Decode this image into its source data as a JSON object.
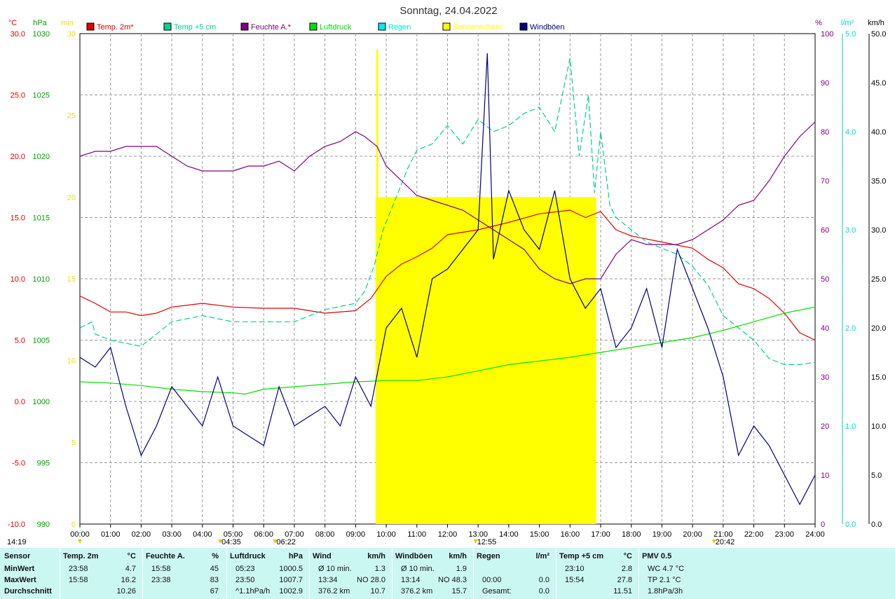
{
  "chart_data": {
    "type": "line",
    "title": "Sonntag, 24.04.2022",
    "x_labels": [
      "00:00",
      "01:00",
      "02:00",
      "03:00",
      "04:00",
      "05:00",
      "06:00",
      "07:00",
      "08:00",
      "09:00",
      "10:00",
      "11:00",
      "12:00",
      "13:00",
      "14:00",
      "15:00",
      "16:00",
      "17:00",
      "18:00",
      "19:00",
      "20:00",
      "21:00",
      "22:00",
      "23:00",
      "24:00"
    ],
    "axes": {
      "temp_c": {
        "unit": "°C",
        "ylim": [
          -10,
          30
        ],
        "ticks": [
          "30.0",
          "25.0",
          "20.0",
          "15.0",
          "10.0",
          "5.0",
          "0.0",
          "-5.0",
          "-10.0"
        ],
        "color": "#e00000"
      },
      "pressure_hpa": {
        "unit": "hPa",
        "ylim": [
          990,
          1030
        ],
        "ticks": [
          "1030",
          "1025",
          "1020",
          "1015",
          "1010",
          "1005",
          "1000",
          "995",
          "990"
        ],
        "color": "#00a000"
      },
      "sun_min": {
        "unit": "min",
        "ylim": [
          0,
          30
        ],
        "ticks": [
          "30",
          "25",
          "20",
          "15",
          "10",
          "5",
          "0"
        ],
        "color": "#e8e000"
      },
      "humidity_pct": {
        "unit": "%",
        "ylim": [
          0,
          100
        ],
        "ticks": [
          "100",
          "90",
          "80",
          "70",
          "60",
          "50",
          "40",
          "30",
          "20",
          "10",
          "0"
        ],
        "color": "#800080"
      },
      "rain_lm2": {
        "unit": "l/m²",
        "ylim": [
          0,
          5
        ],
        "ticks": [
          "5.0",
          "4.0",
          "3.0",
          "2.0",
          "1.0",
          "0.0"
        ],
        "color": "#00d8d8"
      },
      "wind_kmh": {
        "unit": "km/h",
        "ylim": [
          0,
          50
        ],
        "ticks": [
          "50.0",
          "45.0",
          "40.0",
          "35.0",
          "30.0",
          "25.0",
          "20.0",
          "15.0",
          "10.0",
          "5.0",
          "0.0"
        ],
        "color": "#000000"
      }
    },
    "legend": [
      {
        "name": "Temp. 2m*",
        "color": "#e00000"
      },
      {
        "name": "Temp +5 cm",
        "color": "#00d090"
      },
      {
        "name": "Feuchte A.*",
        "color": "#800080"
      },
      {
        "name": "Luftdruck",
        "color": "#00e000"
      },
      {
        "name": "Regen",
        "color": "#00e8e8"
      },
      {
        "name": "Sonnenschein",
        "color": "#ffff00"
      },
      {
        "name": "Windböen",
        "color": "#000080"
      }
    ],
    "series": [
      {
        "name": "Temp. 2m*",
        "axis": "temp_c",
        "x": [
          0,
          0.5,
          1,
          1.5,
          2,
          2.5,
          3,
          4,
          5,
          6,
          7,
          8,
          9,
          9.5,
          10,
          10.5,
          11,
          11.5,
          12,
          13,
          14,
          15,
          16,
          16.5,
          17,
          17.5,
          18,
          19,
          20,
          20.5,
          21,
          21.5,
          22,
          22.5,
          23,
          23.5,
          24
        ],
        "y": [
          8.6,
          8,
          7.3,
          7.3,
          7,
          7.2,
          7.7,
          8,
          7.7,
          7.6,
          7.6,
          7.2,
          7.4,
          8.4,
          10.2,
          11.2,
          11.8,
          12.5,
          13.6,
          14,
          14.6,
          15.3,
          15.6,
          15,
          15.5,
          14,
          13.5,
          13,
          12.5,
          11.6,
          10.9,
          9.6,
          9.2,
          8.4,
          7.2,
          5.6,
          5
        ]
      },
      {
        "name": "Temp +5 cm",
        "axis": "temp_c",
        "x": [
          0,
          0.4,
          0.5,
          1,
          2,
          3,
          4,
          5,
          6,
          7,
          8,
          9,
          9.3,
          9.6,
          9.9,
          10.3,
          10.7,
          11,
          11.5,
          12,
          12.5,
          13,
          13.5,
          14,
          14.5,
          15,
          15.5,
          16,
          16.3,
          16.6,
          16.8,
          17,
          17.3,
          17.5,
          18,
          18.5,
          19,
          19.5,
          20,
          20.5,
          21,
          21.5,
          22,
          22.5,
          23,
          23.5,
          24
        ],
        "y": [
          6,
          6.5,
          5.5,
          5,
          4.5,
          6.5,
          7,
          6.5,
          6.5,
          6.5,
          7.5,
          8,
          9,
          11,
          14,
          16.5,
          19,
          20.5,
          21,
          22.5,
          21,
          23,
          22,
          22.5,
          23.5,
          24,
          22,
          28,
          20,
          25,
          17,
          22,
          16,
          15,
          14,
          13,
          12.5,
          12,
          11,
          9.5,
          7,
          6,
          5,
          3.5,
          3,
          3,
          3.2
        ]
      },
      {
        "name": "Feuchte A.*",
        "axis": "humidity_pct",
        "x": [
          0,
          0.5,
          1,
          1.5,
          2,
          2.5,
          3,
          3.5,
          4,
          4.5,
          5,
          5.5,
          6,
          6.5,
          7,
          7.5,
          8,
          8.5,
          9,
          9.3,
          9.7,
          10,
          10.5,
          11,
          11.5,
          12,
          12.5,
          13,
          13.5,
          14,
          14.5,
          15,
          15.5,
          16,
          16.5,
          17,
          17.5,
          18,
          18.5,
          19,
          19.5,
          20,
          20.5,
          21,
          21.5,
          22,
          22.5,
          23,
          23.5,
          24
        ],
        "y": [
          75,
          76,
          76,
          77,
          77,
          77,
          75,
          73,
          72,
          72,
          72,
          73,
          73,
          74,
          72,
          75,
          77,
          78,
          80,
          79,
          77,
          73,
          70,
          67,
          66,
          65,
          64,
          62,
          60,
          58,
          56,
          52,
          50,
          49,
          50,
          50,
          55,
          58,
          57,
          57,
          57,
          58,
          60,
          62,
          65,
          66,
          70,
          75,
          79,
          82
        ]
      },
      {
        "name": "Luftdruck",
        "axis": "pressure_hpa",
        "x": [
          0,
          1,
          2,
          3,
          4,
          5,
          5.4,
          6,
          7,
          8,
          9,
          10,
          11,
          12,
          13,
          14,
          15,
          16,
          17,
          18,
          19,
          20,
          21,
          22,
          23,
          24
        ],
        "y": [
          1001.6,
          1001.5,
          1001.3,
          1001,
          1000.8,
          1000.7,
          1000.6,
          1001,
          1001.2,
          1001.4,
          1001.6,
          1001.7,
          1001.7,
          1002,
          1002.5,
          1003,
          1003.3,
          1003.6,
          1004,
          1004.4,
          1004.8,
          1005.2,
          1005.8,
          1006.5,
          1007.2,
          1007.7
        ]
      },
      {
        "name": "Windböen",
        "axis": "wind_kmh",
        "x": [
          0,
          0.5,
          1,
          1.5,
          2,
          2.5,
          3,
          3.5,
          4,
          4.5,
          5,
          5.5,
          6,
          6.5,
          7,
          7.5,
          8,
          8.5,
          9,
          9.5,
          10,
          10.5,
          11,
          11.5,
          12,
          12.5,
          13,
          13.3,
          13.5,
          14,
          14.5,
          15,
          15.5,
          16,
          16.5,
          17,
          17.5,
          18,
          18.5,
          19,
          19.5,
          20,
          20.5,
          21,
          21.5,
          22,
          22.5,
          23,
          23.5,
          24
        ],
        "y": [
          17,
          16,
          18,
          12,
          7,
          10,
          14,
          12,
          10,
          15,
          10,
          9,
          8,
          14,
          10,
          11,
          12,
          10,
          15,
          12,
          20,
          22,
          17,
          25,
          26,
          28,
          30,
          48,
          27,
          34,
          30,
          28,
          34,
          25,
          22,
          24,
          18,
          20,
          24,
          18,
          28,
          24,
          20,
          15,
          7,
          10,
          8,
          5,
          2,
          5
        ]
      }
    ],
    "sunshine": {
      "name": "Sonnenschein",
      "axis": "sun_min",
      "x_start": 9.65,
      "x_end": 16.85,
      "value": 20,
      "peak": {
        "x": 9.72,
        "value": 29
      }
    },
    "markers": [
      {
        "label": "14:19",
        "x": 0
      },
      {
        "label": "04:35",
        "x": 4.58
      },
      {
        "label": "06:22",
        "x": 6.37
      },
      {
        "label": "12:55",
        "x": 12.92
      },
      {
        "label": "20:42",
        "x": 20.7
      }
    ]
  },
  "stats": {
    "columns": [
      {
        "header": "Sensor",
        "unit": "",
        "rows": [
          "MinWert",
          "MaxWert",
          "Durchschnitt"
        ]
      },
      {
        "header": "Temp. 2m",
        "unit": "°C",
        "rows": [
          [
            "23:58",
            "4.7"
          ],
          [
            "15:58",
            "16.2"
          ],
          [
            "",
            "10.26"
          ]
        ]
      },
      {
        "header": "Feuchte A.",
        "unit": "%",
        "rows": [
          [
            "15:58",
            "45"
          ],
          [
            "23:38",
            "83"
          ],
          [
            "",
            "67"
          ]
        ]
      },
      {
        "header": "Luftdruck",
        "unit": "hPa",
        "rows": [
          [
            "05:23",
            "1000.5"
          ],
          [
            "23:50",
            "1007.7"
          ],
          [
            "^1.1hPa/h",
            "1002.9"
          ]
        ]
      },
      {
        "header": "Wind",
        "unit": "km/h",
        "rows": [
          [
            "Ø 10 min.",
            "1.3"
          ],
          [
            "13:34",
            "NO 28.0"
          ],
          [
            "376.2 km",
            "10.7"
          ]
        ]
      },
      {
        "header": "Windböen",
        "unit": "km/h",
        "rows": [
          [
            "Ø 10 min.",
            "1.9"
          ],
          [
            "13:14",
            "NO 48.3"
          ],
          [
            "376.2 km",
            "15.7"
          ]
        ]
      },
      {
        "header": "Regen",
        "unit": "l/m²",
        "rows": [
          [
            "",
            ""
          ],
          [
            "00:00",
            "0.0"
          ],
          [
            "Gesamt:",
            "0.0"
          ]
        ]
      },
      {
        "header": "Temp +5 cm",
        "unit": "°C",
        "rows": [
          [
            "23:10",
            "2.8"
          ],
          [
            "15:54",
            "27.8"
          ],
          [
            "",
            "11.51"
          ]
        ]
      },
      {
        "header": "PMV 0.5",
        "unit": "",
        "rows": [
          [
            "WC 4.7 °C",
            ""
          ],
          [
            "TP 2.1 °C",
            ""
          ],
          [
            "1.8hPa/3h",
            ""
          ]
        ]
      }
    ]
  }
}
